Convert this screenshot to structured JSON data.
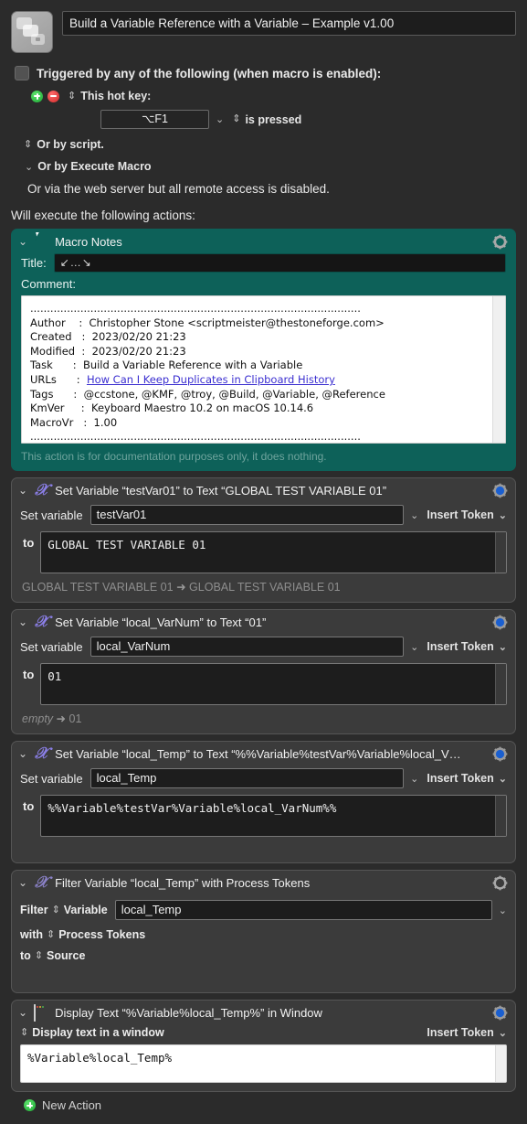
{
  "header": {
    "macro_title": "Build a Variable Reference with a Variable – Example v1.00",
    "icon_name": "macro-group-icon",
    "trigger_checkbox_label": "Triggered by any of the following (when macro is enabled):",
    "hotkey_trigger_label": "This hot key:",
    "hotkey_value": "⌥F1",
    "is_pressed_label": "is pressed",
    "or_by_script_label": "Or by script.",
    "or_by_execute_macro_label": "Or by Execute Macro",
    "web_server_note": "Or via the web server but all remote access is disabled.",
    "will_execute_label": "Will execute the following actions:"
  },
  "notes_action": {
    "title": "Macro Notes",
    "title_field_label": "Title:",
    "title_field_value": "↙…↘",
    "comment_label": "Comment:",
    "comment_text": "...................................................................................................\nAuthor    :  Christopher Stone <scriptmeister@thestoneforge.com>\nCreated   :  2023/02/20 21:23\nModified  :  2023/02/20 21:23\nTask      :  Build a Variable Reference with a Variable\nURLs      :  ",
    "comment_link": "How Can I Keep Duplicates in Clipboard History",
    "comment_text_2": "\nTags      :  @ccstone, @KMF, @troy, @Build, @Variable, @Reference\nKmVer     :  Keyboard Maestro 10.2 on macOS 10.14.6\nMacroVr   :  1.00\n...................................................................................................",
    "footer_note": "This action is for documentation purposes only, it does nothing.",
    "accent_color": "#0d6159"
  },
  "actions": [
    {
      "id": "set-variable-testvar01",
      "title": "Set Variable “testVar01” to Text “GLOBAL TEST VARIABLE 01”",
      "icon": "variable-x-icon",
      "gear": "blue",
      "set_variable_label": "Set variable",
      "variable_name": "testVar01",
      "insert_token_label": "Insert Token",
      "to_label": "to",
      "text_value": "GLOBAL TEST VARIABLE 01",
      "result_before": "GLOBAL TEST VARIABLE 01",
      "result_after": "GLOBAL TEST VARIABLE 01",
      "result_arrow": "➜"
    },
    {
      "id": "set-variable-local-varnum",
      "title": "Set Variable “local_VarNum” to Text “01”",
      "icon": "variable-x-icon",
      "gear": "blue",
      "set_variable_label": "Set variable",
      "variable_name": "local_VarNum",
      "insert_token_label": "Insert Token",
      "to_label": "to",
      "text_value": "01",
      "result_before": "empty",
      "result_after": "01",
      "result_arrow": "➜"
    },
    {
      "id": "set-variable-local-temp",
      "title": "Set Variable “local_Temp” to Text “%%Variable%testVar%Variable%local_V…",
      "icon": "variable-x-icon",
      "gear": "blue",
      "set_variable_label": "Set variable",
      "variable_name": "local_Temp",
      "insert_token_label": "Insert Token",
      "to_label": "to",
      "text_value": "%%Variable%testVar%Variable%local_VarNum%%",
      "result_before": "",
      "result_after": "",
      "result_arrow": ""
    }
  ],
  "filter_action": {
    "id": "filter-variable-local-temp",
    "title": "Filter Variable “local_Temp” with Process Tokens",
    "icon": "variable-x-icon",
    "gear": "grey",
    "filter_label": "Filter",
    "source_kind_label": "Variable",
    "variable_name": "local_Temp",
    "with_label": "with",
    "filter_kind_label": "Process Tokens",
    "to_label": "to",
    "destination_label": "Source"
  },
  "display_action": {
    "id": "display-text-in-window",
    "title": "Display Text “%Variable%local_Temp%” in Window",
    "icon": "display-window-icon",
    "gear": "blue",
    "mode_label": "Display text in a window",
    "insert_token_label": "Insert Token",
    "text_value": "%Variable%local_Temp%"
  },
  "footer": {
    "new_action_label": "New Action",
    "new_action_icon": "plus-circle-icon"
  },
  "colors": {
    "window_bg": "#2b2b2b",
    "action_bg": "#3b3b3b",
    "notes_bg": "#0d6159",
    "gear_blue": "#1a5fd0",
    "gear_grey": "#a8a8a8",
    "link_blue": "#3b2fd0",
    "variable_icon": "#8b7fe8",
    "green": "#1faa36",
    "red": "#d22b2b"
  }
}
